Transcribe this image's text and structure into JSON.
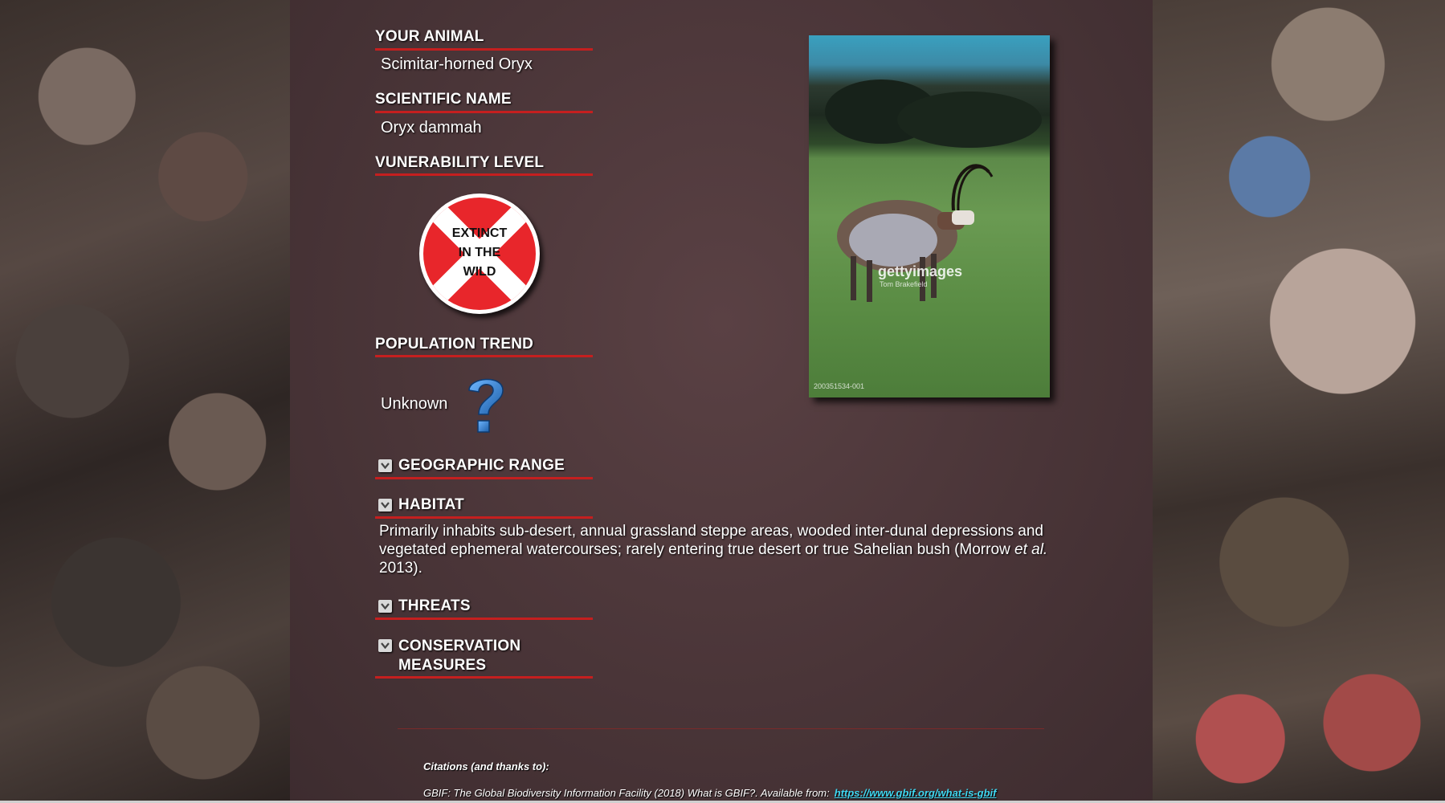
{
  "animal": {
    "heading": "YOUR ANIMAL",
    "value": "Scimitar-horned Oryx"
  },
  "scientific": {
    "heading": "SCIENTIFIC NAME",
    "value": "Oryx dammah"
  },
  "vulnerability": {
    "heading": "VUNERABILITY LEVEL",
    "badge_text": "EXTINCT\nIN THE\nWILD"
  },
  "population": {
    "heading": "POPULATION TREND",
    "value": "Unknown",
    "icon": "question-mark-icon"
  },
  "sections": {
    "geographic_range": "GEOGRAPHIC RANGE",
    "habitat": "HABITAT",
    "threats": "THREATS",
    "conservation": "CONSERVATION MEASURES"
  },
  "habitat_text": {
    "part1": "Primarily inhabits sub-desert, annual grassland steppe areas, wooded inter-dunal depressions and vegetated ephemeral watercourses; rarely entering true desert or true Sahelian bush (Morrow ",
    "italic": "et al.",
    "part2": " 2013)."
  },
  "photo": {
    "watermark": "gettyimages",
    "credit": "Tom Brakefield",
    "id": "200351534-001"
  },
  "citations": {
    "title": "Citations (and thanks to):",
    "line": "GBIF: The Global Biodiversity Information Facility (2018) What is GBIF?. Available from:",
    "link": "https://www.gbif.org/what-is-gbif"
  },
  "colors": {
    "accent_rule": "#c51f1f",
    "badge_red": "#e8262b",
    "link": "#3fd6f0"
  }
}
